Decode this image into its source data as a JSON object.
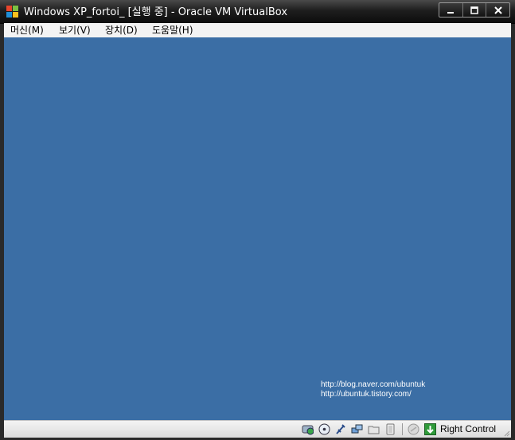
{
  "window": {
    "title": "Windows XP_fortoi_ [실행 중] - Oracle VM VirtualBox",
    "app_icon": "virtualbox-logo-icon",
    "controls": [
      "minimize-icon",
      "maximize-icon",
      "close-icon"
    ]
  },
  "menu": {
    "items": [
      {
        "label": "머신(M)"
      },
      {
        "label": "보기(V)"
      },
      {
        "label": "장치(D)"
      },
      {
        "label": "도움말(H)"
      }
    ]
  },
  "guest_screen": {
    "background_color": "#3b6ea5",
    "lines": [
      "http://blog.naver.com/ubuntuk",
      "http://ubuntuk.tistory.com/"
    ]
  },
  "status_bar": {
    "icons": [
      "hard-disk-icon",
      "cd-dvd-icon",
      "usb-icon",
      "network-icon",
      "shared-folders-icon",
      "display-icon",
      "mouse-integration-icon",
      "host-key-indicator-icon"
    ],
    "host_key": "Right Control"
  }
}
